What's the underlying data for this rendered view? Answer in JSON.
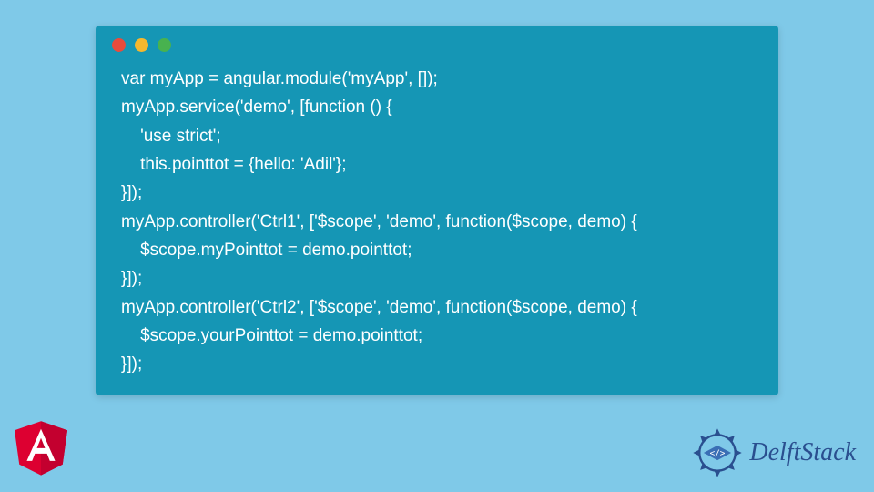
{
  "code": {
    "lines": [
      "var myApp = angular.module('myApp', []);",
      "myApp.service('demo', [function () {",
      "    'use strict';",
      "    this.pointtot = {hello: 'Adil'};",
      "}]);",
      "myApp.controller('Ctrl1', ['$scope', 'demo', function($scope, demo) {",
      "    $scope.myPointtot = demo.pointtot;",
      "}]);",
      "myApp.controller('Ctrl2', ['$scope', 'demo', function($scope, demo) {",
      "    $scope.yourPointtot = demo.pointtot;",
      "}]);"
    ]
  },
  "brand": {
    "name": "DelftStack"
  }
}
